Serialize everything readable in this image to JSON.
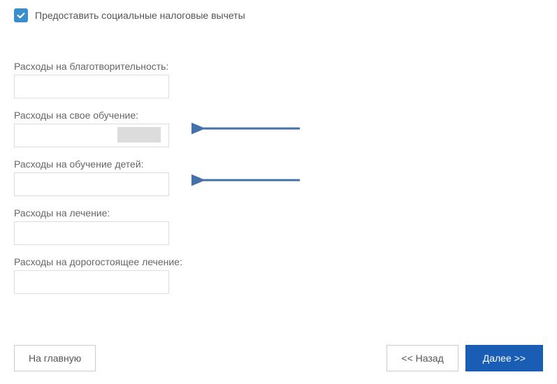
{
  "checkbox": {
    "label": "Предоставить социальные налоговые вычеты",
    "checked": true
  },
  "fields": {
    "charity": {
      "label": "Расходы на благотворительность:",
      "value": ""
    },
    "ownEducation": {
      "label": "Расходы на свое обучение:",
      "value": ""
    },
    "childrenEducation": {
      "label": "Расходы на обучение детей:",
      "value": ""
    },
    "treatment": {
      "label": "Расходы на лечение:",
      "value": ""
    },
    "expensiveTreatment": {
      "label": "Расходы на дорогостоящее лечение:",
      "value": ""
    }
  },
  "buttons": {
    "home": "На главную",
    "back": "<< Назад",
    "next": "Далее >>"
  }
}
